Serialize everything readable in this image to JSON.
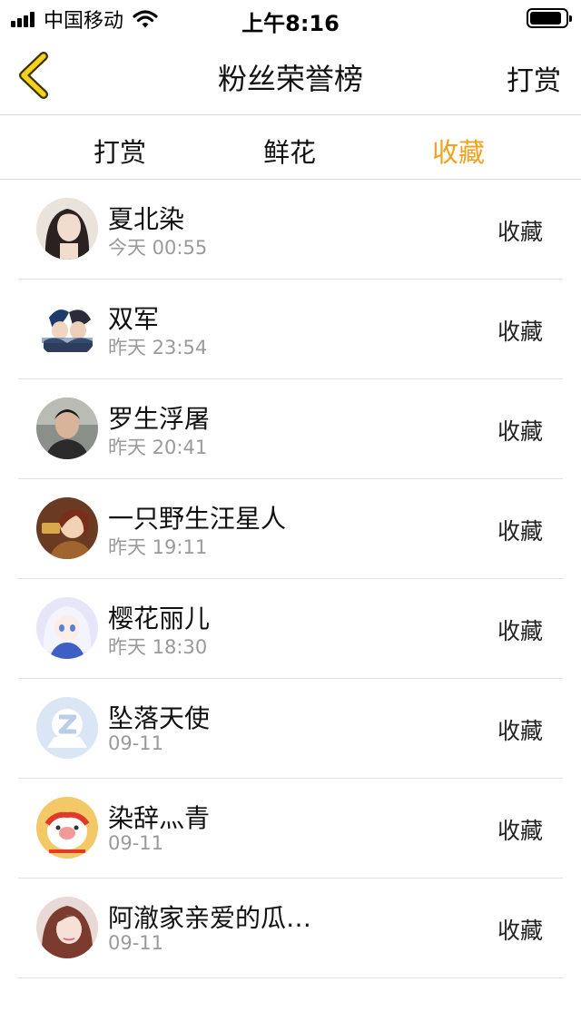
{
  "status_bar": {
    "carrier": "中国移动",
    "time": "上午8:16",
    "battery_level": 0.9
  },
  "nav": {
    "title": "粉丝荣誉榜",
    "right_label": "打赏",
    "back_icon": "chevron-left-icon",
    "accent": "#f0a21e"
  },
  "tabs": [
    {
      "label": "打赏",
      "active": false
    },
    {
      "label": "鲜花",
      "active": false
    },
    {
      "label": "收藏",
      "active": true
    }
  ],
  "fans": [
    {
      "name": "夏北染",
      "time": "今天 00:55",
      "action": "收藏",
      "avatar": "avatar-photo-girl"
    },
    {
      "name": "双军",
      "time": "昨天 23:54",
      "action": "收藏",
      "avatar": "avatar-anime-characters"
    },
    {
      "name": "罗生浮屠",
      "time": "昨天 20:41",
      "action": "收藏",
      "avatar": "avatar-photo-man"
    },
    {
      "name": "一只野生汪星人",
      "time": "昨天 19:11",
      "action": "收藏",
      "avatar": "avatar-anime-girl"
    },
    {
      "name": "樱花丽儿",
      "time": "昨天 18:30",
      "action": "收藏",
      "avatar": "avatar-anime-white-hair"
    },
    {
      "name": "坠落天使",
      "time": "09-11",
      "action": "收藏",
      "avatar": "avatar-default-qq"
    },
    {
      "name": "染辞灬青",
      "time": "09-11",
      "action": "收藏",
      "avatar": "avatar-cartoon-pig"
    },
    {
      "name": "阿澈家亲爱的瓜…",
      "time": "09-11",
      "action": "收藏",
      "avatar": "avatar-photo-cosplay"
    }
  ]
}
